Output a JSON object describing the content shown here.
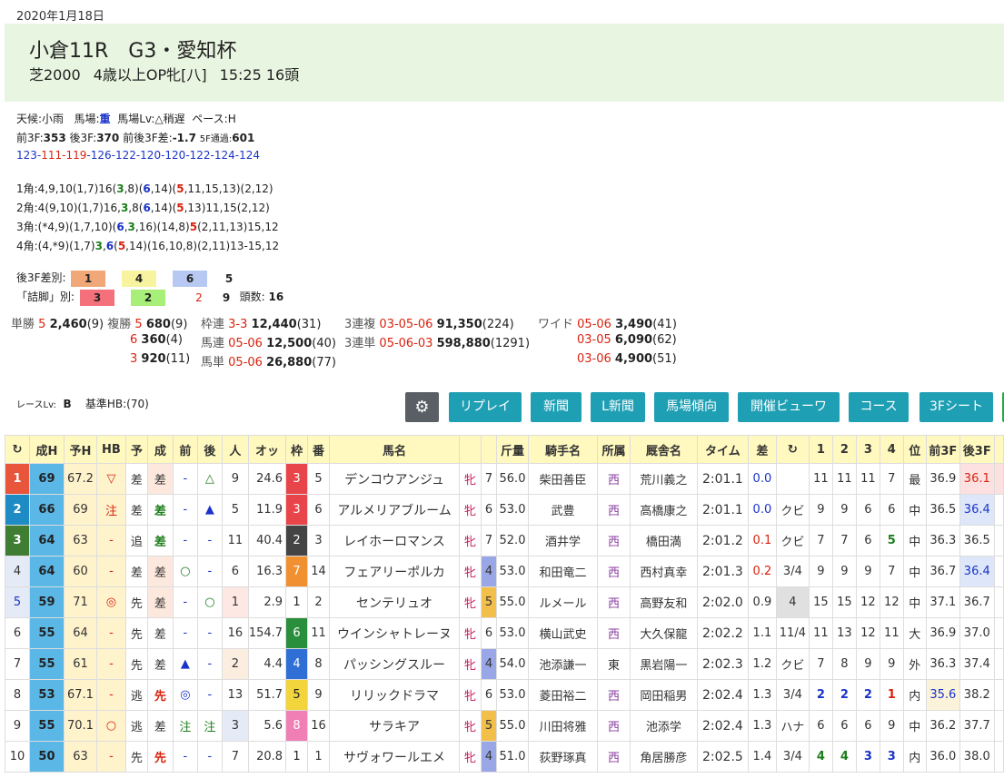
{
  "date": "2020年1月18日",
  "race": {
    "title": "小倉11R",
    "grade": "G3・愛知杯",
    "surface": "芝2000",
    "cond": "4歳以上OP牝[八]",
    "time_heads": "15:25 16頭"
  },
  "weather": {
    "weather": "天候:小雨",
    "baba_label": "馬場:",
    "baba_val": "重",
    "babalv_label": "馬場Lv:",
    "babalv_val": "△稍遅",
    "pace_label": "ペース:",
    "pace_val": "H"
  },
  "laps": {
    "f3_label": "前3F:",
    "f3": "353",
    "l3_label": "後3F:",
    "l3": "370",
    "diff_label": "前後3F差:",
    "diff": "-1.7",
    "f5_label": "5F通過:",
    "f5": "601",
    "lap_a": "123-",
    "lap_b": "111-119",
    "lap_c": "-126-122-120-120-122-124-124"
  },
  "corners": [
    {
      "p1": "1角:4,9,10(1,7)16(",
      "g": "3",
      "p2": ",8)(",
      "b": "6",
      "p3": ",14)(",
      "r": "5",
      "p4": ",11,15,13)(2,12)"
    },
    {
      "p1": "2角:4(9,10)(1,7)16,",
      "g": "3",
      "p2": ",8(",
      "b": "6",
      "p3": ",14)(",
      "r": "5",
      "p4": ",13)11,15(2,12)"
    },
    {
      "p1": "3角:(*4,9)(1,7,10)(",
      "b": "6",
      "p2": ",",
      "g": "3",
      "p3": ",16)(14,8)",
      "r": "5",
      "p4": "(2,11,13)15,12"
    },
    {
      "p1": "4角:(4,*9)(1,7)",
      "g": "3",
      "p2": ",",
      "b": "6",
      "p3": "(",
      "r": "5",
      "p4": ",14)(16,10,8)(2,11)13-15,12"
    }
  ],
  "stats": {
    "l3_label": "後3F差別:",
    "l3_c1": "1",
    "l3_c2": "4",
    "l3_c3": "6",
    "l3_c4": "5",
    "tsume_label": "「詰脚」別:",
    "ts_c1": "3",
    "ts_c2": "2",
    "ts_c3": "2",
    "ts_c4": "9",
    "heads_label": "頭数:",
    "heads": "16"
  },
  "payouts": {
    "tansho": "単勝",
    "tansho_n": "5",
    "tansho_a": "2,460",
    "tansho_p": "(9)",
    "fukusho": "複勝",
    "fuku": [
      {
        "n": "5",
        "a": "680",
        "p": "(9)"
      },
      {
        "n": "6",
        "a": "360",
        "p": "(4)"
      },
      {
        "n": "3",
        "a": "920",
        "p": "(11)"
      }
    ],
    "wakuren": "枠連",
    "wakuren_n": "3-3",
    "wakuren_a": "12,440",
    "wakuren_p": "(31)",
    "umaren": "馬連",
    "umaren_n": "05-06",
    "umaren_a": "12,500",
    "umaren_p": "(40)",
    "umatan": "馬単",
    "umatan_n": "05-06",
    "umatan_a": "26,880",
    "umatan_p": "(77)",
    "sanfuku": "3連複",
    "sanfuku_n": "03-05-06",
    "sanfuku_a": "91,350",
    "sanfuku_p": "(224)",
    "santan": "3連単",
    "santan_n": "05-06-03",
    "santan_a": "598,880",
    "santan_p": "(1291)",
    "wide": "ワイド",
    "wides": [
      {
        "n": "05-06",
        "a": "3,490",
        "p": "(41)"
      },
      {
        "n": "03-05",
        "a": "6,090",
        "p": "(62)"
      },
      {
        "n": "03-06",
        "a": "4,900",
        "p": "(51)"
      }
    ]
  },
  "level": {
    "label": "レースLv:",
    "val": "B",
    "base": "基準HB:(70)"
  },
  "buttons": [
    "リプレイ",
    "新聞",
    "L新聞",
    "馬場傾向",
    "開催ビューワ",
    "コース",
    "3Fシート"
  ],
  "headers": [
    "↻",
    "成H",
    "予H",
    "HB",
    "予",
    "成",
    "前",
    "後",
    "人",
    "オッ",
    "枠",
    "番",
    "馬名",
    "",
    "",
    "斤量",
    "騎手名",
    "所属",
    "厩舎名",
    "タイム",
    "差",
    "↻",
    "1",
    "2",
    "3",
    "4",
    "位",
    "前3F",
    "後3F",
    ""
  ],
  "rows": [
    {
      "pos": "1",
      "seih": "69",
      "yoh": "67.2",
      "hb": "▽",
      "yo": "差",
      "sei": "差",
      "mae": "-",
      "ato": "△",
      "nin": "9",
      "odds": "24.6",
      "waku": "3",
      "ban": "5",
      "name": "デンコウアンジュ",
      "sex": "牝",
      "age": "7",
      "kin": "56.0",
      "jk": "柴田善臣",
      "sho": "西",
      "tr": "荒川義之",
      "time": "2:01.1",
      "sa": "0.0",
      "ch": "",
      "c1": "11",
      "c2": "11",
      "c3": "11",
      "c4": "7",
      "ii": "最",
      "f3": "36.9",
      "l3": "36.1"
    },
    {
      "pos": "2",
      "seih": "66",
      "yoh": "69",
      "hb": "注",
      "yo": "差",
      "sei": "差",
      "mae": "-",
      "ato": "▲",
      "nin": "5",
      "odds": "11.9",
      "waku": "3",
      "ban": "6",
      "name": "アルメリアブルーム",
      "sex": "牝",
      "age": "6",
      "kin": "53.0",
      "jk": "武豊",
      "sho": "西",
      "tr": "高橋康之",
      "time": "2:01.1",
      "sa": "0.0",
      "ch": "クビ",
      "c1": "9",
      "c2": "9",
      "c3": "6",
      "c4": "6",
      "ii": "中",
      "f3": "36.5",
      "l3": "36.4"
    },
    {
      "pos": "3",
      "seih": "64",
      "yoh": "63",
      "hb": "-",
      "yo": "追",
      "sei": "差",
      "mae": "-",
      "ato": "-",
      "nin": "11",
      "odds": "40.4",
      "waku": "2",
      "ban": "3",
      "name": "レイホーロマンス",
      "sex": "牝",
      "age": "7",
      "kin": "52.0",
      "jk": "酒井学",
      "sho": "西",
      "tr": "橋田満",
      "time": "2:01.2",
      "sa": "0.1",
      "ch": "クビ",
      "c1": "7",
      "c2": "7",
      "c3": "6",
      "c4": "5",
      "ii": "中",
      "f3": "36.3",
      "l3": "36.5"
    },
    {
      "pos": "4",
      "seih": "64",
      "yoh": "60",
      "hb": "-",
      "yo": "差",
      "sei": "差",
      "mae": "○",
      "ato": "-",
      "nin": "6",
      "odds": "16.3",
      "waku": "7",
      "ban": "14",
      "name": "フェアリーポルカ",
      "sex": "牝",
      "age": "4",
      "kin": "53.0",
      "jk": "和田竜二",
      "sho": "西",
      "tr": "西村真幸",
      "time": "2:01.3",
      "sa": "0.2",
      "ch": "3/4",
      "c1": "9",
      "c2": "9",
      "c3": "9",
      "c4": "7",
      "ii": "中",
      "f3": "36.7",
      "l3": "36.4"
    },
    {
      "pos": "5",
      "seih": "59",
      "yoh": "71",
      "hb": "◎",
      "yo": "先",
      "sei": "差",
      "mae": "-",
      "ato": "○",
      "nin": "1",
      "odds": "2.9",
      "waku": "1",
      "ban": "2",
      "name": "センテリュオ",
      "sex": "牝",
      "age": "5",
      "kin": "55.0",
      "jk": "ルメール",
      "sho": "西",
      "tr": "高野友和",
      "time": "2:02.0",
      "sa": "0.9",
      "ch": "4",
      "c1": "15",
      "c2": "15",
      "c3": "12",
      "c4": "12",
      "ii": "中",
      "f3": "37.1",
      "l3": "36.7"
    },
    {
      "pos": "6",
      "seih": "55",
      "yoh": "64",
      "hb": "-",
      "yo": "先",
      "sei": "差",
      "mae": "-",
      "ato": "-",
      "nin": "16",
      "odds": "154.7",
      "waku": "6",
      "ban": "11",
      "name": "ウインシャトレーヌ",
      "sex": "牝",
      "age": "6",
      "kin": "53.0",
      "jk": "横山武史",
      "sho": "西",
      "tr": "大久保龍",
      "time": "2:02.2",
      "sa": "1.1",
      "ch": "11/4",
      "c1": "11",
      "c2": "13",
      "c3": "12",
      "c4": "11",
      "ii": "大",
      "f3": "36.9",
      "l3": "37.0"
    },
    {
      "pos": "7",
      "seih": "55",
      "yoh": "61",
      "hb": "-",
      "yo": "先",
      "sei": "差",
      "mae": "▲",
      "ato": "-",
      "nin": "2",
      "odds": "4.4",
      "waku": "4",
      "ban": "8",
      "name": "パッシングスルー",
      "sex": "牝",
      "age": "4",
      "kin": "54.0",
      "jk": "池添謙一",
      "sho": "東",
      "tr": "黒岩陽一",
      "time": "2:02.3",
      "sa": "1.2",
      "ch": "クビ",
      "c1": "7",
      "c2": "8",
      "c3": "9",
      "c4": "9",
      "ii": "外",
      "f3": "36.3",
      "l3": "37.4"
    },
    {
      "pos": "8",
      "seih": "53",
      "yoh": "67.1",
      "hb": "-",
      "yo": "逃",
      "sei": "先",
      "mae": "◎",
      "ato": "-",
      "nin": "13",
      "odds": "51.7",
      "waku": "5",
      "ban": "9",
      "name": "リリックドラマ",
      "sex": "牝",
      "age": "6",
      "kin": "53.0",
      "jk": "菱田裕二",
      "sho": "西",
      "tr": "岡田稲男",
      "time": "2:02.4",
      "sa": "1.3",
      "ch": "3/4",
      "c1": "2",
      "c2": "2",
      "c3": "2",
      "c4": "1",
      "ii": "内",
      "f3": "35.6",
      "l3": "38.2"
    },
    {
      "pos": "9",
      "seih": "55",
      "yoh": "70.1",
      "hb": "○",
      "yo": "逃",
      "sei": "差",
      "mae": "注",
      "ato": "注",
      "nin": "3",
      "odds": "5.6",
      "waku": "8",
      "ban": "16",
      "name": "サラキア",
      "sex": "牝",
      "age": "5",
      "kin": "55.0",
      "jk": "川田将雅",
      "sho": "西",
      "tr": "池添学",
      "time": "2:02.4",
      "sa": "1.3",
      "ch": "ハナ",
      "c1": "6",
      "c2": "6",
      "c3": "6",
      "c4": "9",
      "ii": "中",
      "f3": "36.2",
      "l3": "37.7"
    },
    {
      "pos": "10",
      "seih": "50",
      "yoh": "63",
      "hb": "-",
      "yo": "先",
      "sei": "先",
      "mae": "-",
      "ato": "-",
      "nin": "7",
      "odds": "20.8",
      "waku": "1",
      "ban": "1",
      "name": "サヴォワールエメ",
      "sex": "牝",
      "age": "4",
      "kin": "51.0",
      "jk": "荻野琢真",
      "sho": "西",
      "tr": "角居勝彦",
      "time": "2:02.5",
      "sa": "1.4",
      "ch": "3/4",
      "c1": "4",
      "c2": "4",
      "c3": "3",
      "c4": "3",
      "ii": "内",
      "f3": "36.0",
      "l3": "38.0"
    }
  ],
  "colors": {
    "waku1": "#ffffff",
    "waku2": "#444444",
    "waku3": "#e8454a",
    "waku4": "#2f6fd6",
    "waku5": "#f2d43d",
    "waku6": "#2a8f3d",
    "waku7": "#f09030",
    "waku8": "#f07fb6",
    "pos1": "#e8553a",
    "pos2": "#1f8bc4",
    "pos3": "#3f7d33",
    "header": "#fff8bf",
    "button": "#1f9fb4"
  }
}
